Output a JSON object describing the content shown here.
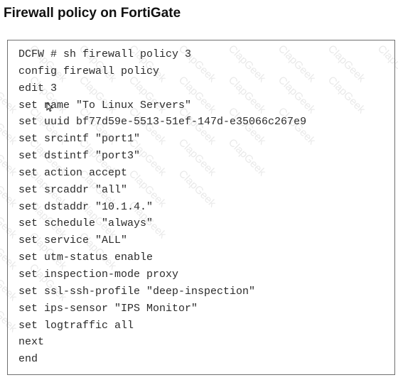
{
  "page": {
    "title": "Firewall policy on FortiGate"
  },
  "watermark": {
    "text": "ClapGeek"
  },
  "terminal": {
    "lines": [
      "DCFW # sh firewall policy 3",
      "config firewall policy",
      "edit 3",
      "set name \"To Linux Servers\"",
      "set uuid bf77d59e-5513-51ef-147d-e35066c267e9",
      "set srcintf \"port1\"",
      "set dstintf \"port3\"",
      "set action accept",
      "set srcaddr \"all\"",
      "set dstaddr \"10.1.4.\"",
      "set schedule \"always\"",
      "set service \"ALL\"",
      "set utm-status enable",
      "set inspection-mode proxy",
      "set ssl-ssh-profile \"deep-inspection\"",
      "set ips-sensor \"IPS Monitor\"",
      "set logtraffic all",
      "next",
      "end"
    ]
  }
}
